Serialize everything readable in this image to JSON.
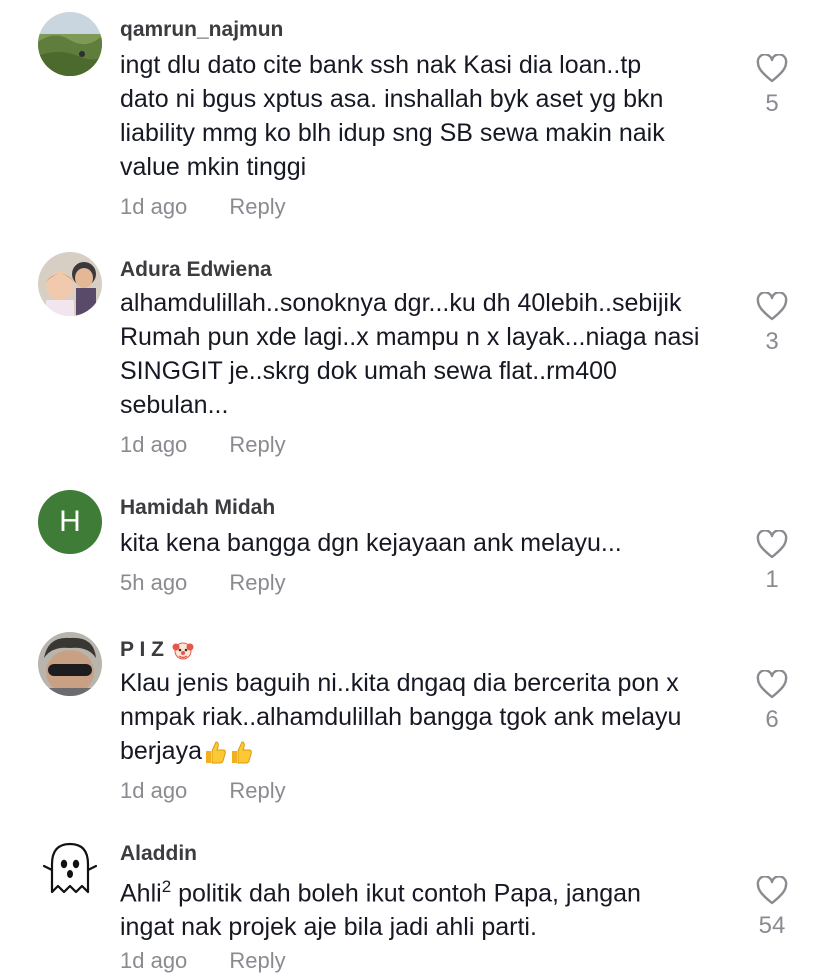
{
  "comments": [
    {
      "username": "qamrun_najmun",
      "lines": [
        "ingt dlu dato cite bank ssh nak Kasi dia loan..tp",
        "dato ni bgus xptus asa. inshallah byk aset yg bkn",
        "liability mmg ko blh idup sng SB sewa makin naik",
        "value mkin tinggi"
      ],
      "time": "1d ago",
      "reply": "Reply",
      "likes": "5",
      "avatar": "landscape-photo"
    },
    {
      "username": "Adura Edwiena",
      "lines": [
        "alhamdulillah..sonoknya dgr...ku dh 40lebih..sebijik",
        "Rumah pun xde lagi..x mampu n x layak...niaga nasi",
        "SINGGIT je..skrg dok umah sewa flat..rm400",
        "sebulan..."
      ],
      "time": "1d ago",
      "reply": "Reply",
      "likes": "3",
      "avatar": "family-photo"
    },
    {
      "username": "Hamidah Midah",
      "lines": [
        "kita kena bangga dgn kejayaan ank melayu..."
      ],
      "time": "5h ago",
      "reply": "Reply",
      "likes": "1",
      "avatar_letter": "H",
      "avatar_color": "#3f7c37"
    },
    {
      "username": "P I Z",
      "lines": [
        "Klau jenis baguih ni..kita dngaq dia bercerita pon x",
        "nmpak riak..alhamdulillah bangga tgok ank melayu",
        "berjaya"
      ],
      "time": "1d ago",
      "reply": "Reply",
      "likes": "6",
      "avatar": "man-sunglasses-photo",
      "username_emoji": "clown-face-icon",
      "text_emoji": "thumbs-up-icon x2"
    },
    {
      "username": "Aladdin",
      "line1_pre": "Ahli",
      "line1_sup": "2",
      "line1_post": " politik dah boleh ikut contoh Papa, jangan",
      "line2": "ingat nak projek aje bila jadi ahli parti.",
      "time": "1d ago",
      "reply": "Reply",
      "likes": "54",
      "avatar": "ghost-icon"
    }
  ],
  "colors": {
    "text": "#161823",
    "muted": "#8a8b91",
    "avatar_green": "#3f7c37"
  }
}
